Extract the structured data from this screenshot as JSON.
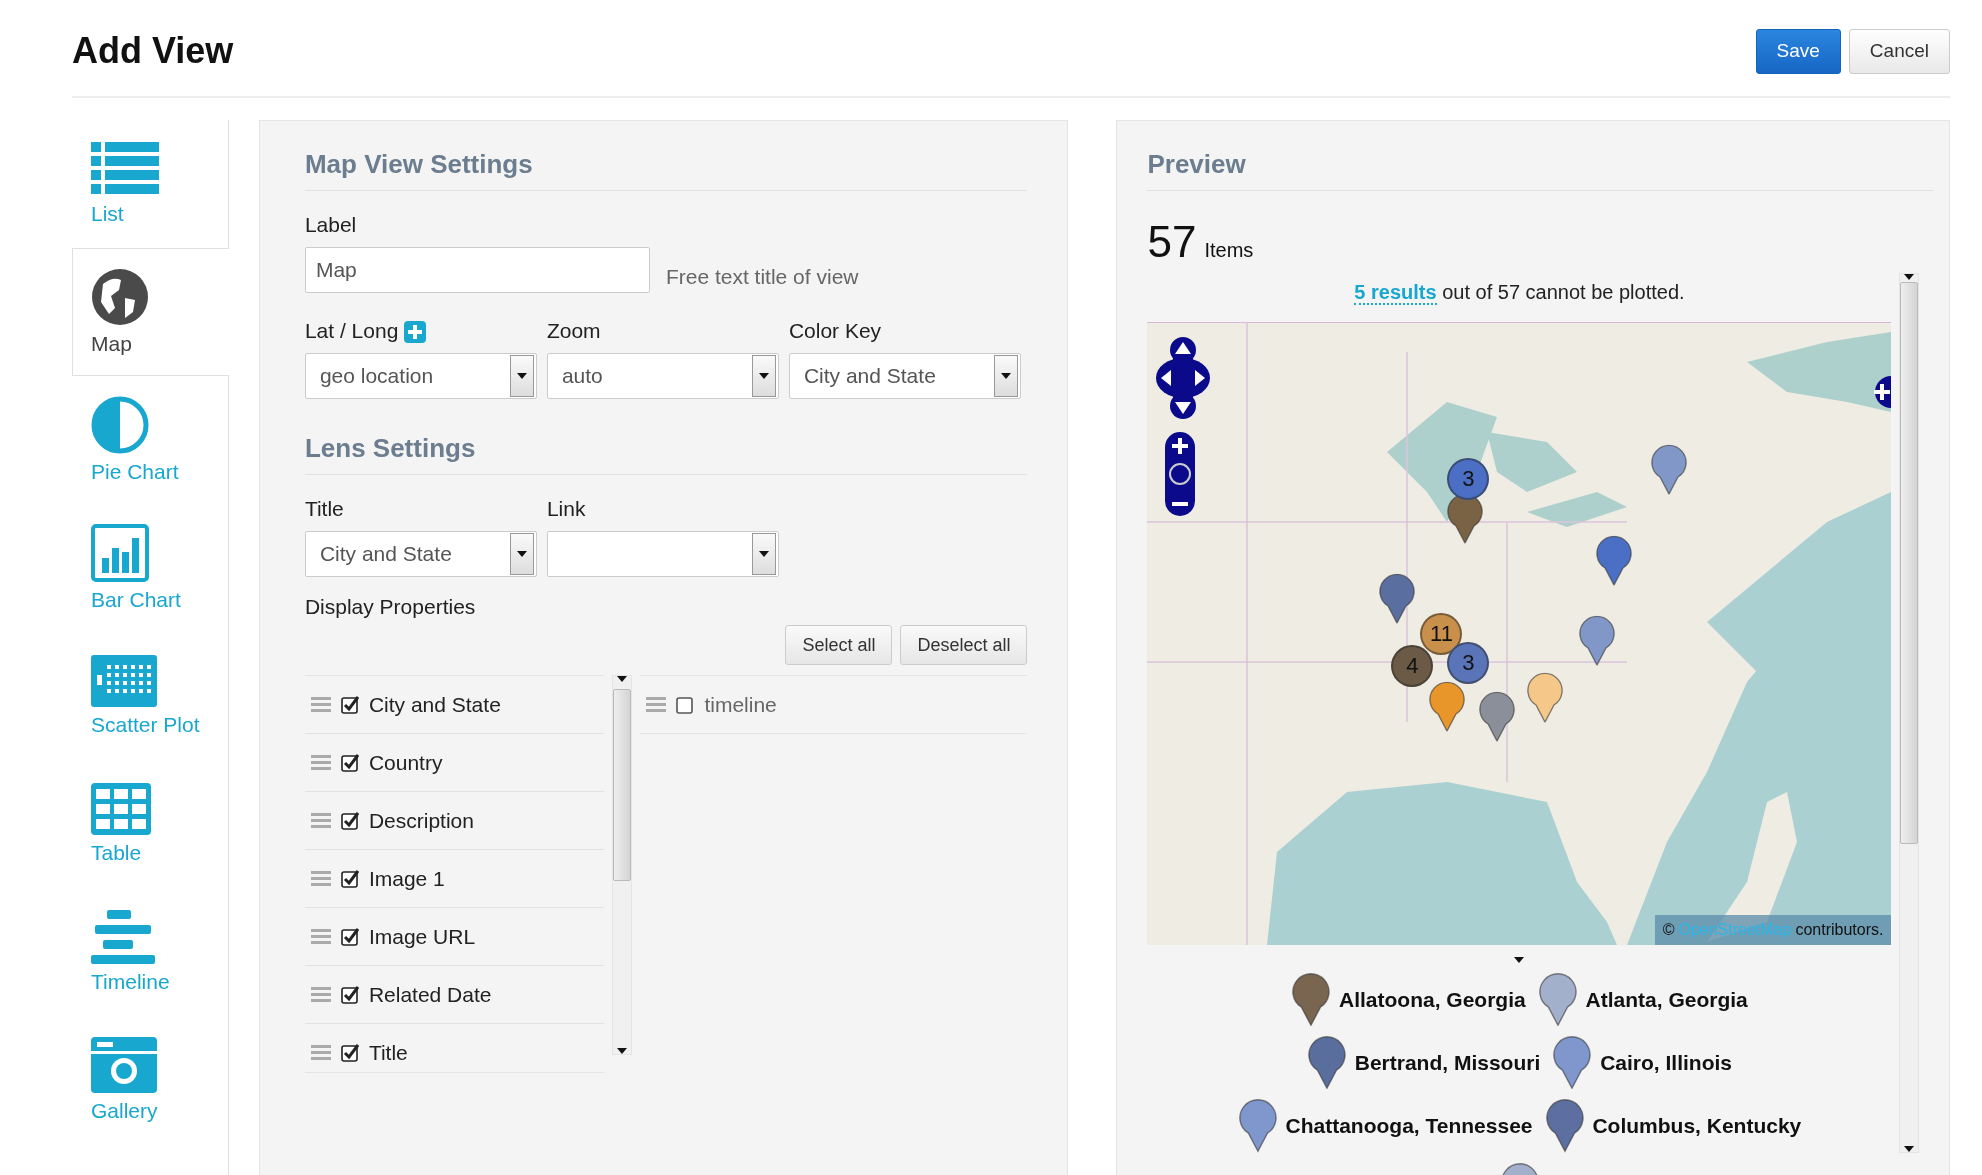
{
  "page": {
    "title": "Add View",
    "buttons": [
      {
        "label": "Save",
        "kind": "primary"
      },
      {
        "label": "Cancel",
        "kind": "default"
      }
    ]
  },
  "sidebar": {
    "items": [
      {
        "label": "List",
        "selected": false
      },
      {
        "label": "Map",
        "selected": true
      },
      {
        "label": "Pie Chart",
        "selected": false
      },
      {
        "label": "Bar Chart",
        "selected": false
      },
      {
        "label": "Scatter Plot",
        "selected": false
      },
      {
        "label": "Table",
        "selected": false
      },
      {
        "label": "Timeline",
        "selected": false
      },
      {
        "label": "Gallery",
        "selected": false
      }
    ]
  },
  "settings": {
    "title": "Map View Settings",
    "label_field": {
      "label": "Label",
      "value": "Map",
      "hint": "Free text title of view"
    },
    "selects": [
      {
        "label": "Lat / Long",
        "value": "geo location",
        "add": true
      },
      {
        "label": "Zoom",
        "value": "auto",
        "add": false
      },
      {
        "label": "Color Key",
        "value": "City and State",
        "add": false
      }
    ],
    "lens": {
      "title": "Lens Settings",
      "selects": [
        {
          "label": "Title",
          "value": "City and State"
        },
        {
          "label": "Link"
        }
      ],
      "display_label": "Display Properties",
      "buttons": [
        "Select all",
        "Deselect all"
      ],
      "shown": [
        {
          "label": "City and State",
          "checked": true
        },
        {
          "label": "Country",
          "checked": true
        },
        {
          "label": "Description",
          "checked": true
        },
        {
          "label": "Image 1",
          "checked": true
        },
        {
          "label": "Image URL",
          "checked": true
        },
        {
          "label": "Related Date",
          "checked": true
        },
        {
          "label": "Title",
          "checked": true
        }
      ],
      "hidden": [
        {
          "label": "timeline",
          "checked": false
        }
      ]
    }
  },
  "preview": {
    "title": "Preview",
    "count": "57",
    "count_label": "Items",
    "notice_link": "5 results",
    "notice": "out of 57 cannot be plotted.",
    "map": {
      "clusters": [
        {
          "label": "3",
          "color": "#4a6fc4"
        },
        {
          "label": "11",
          "color": "#c8904a"
        },
        {
          "label": "4",
          "color": "#6b5a45"
        },
        {
          "label": "3",
          "color": "#5a74b8"
        }
      ],
      "pins": [
        {
          "color": "#7a6245"
        },
        {
          "color": "#8097c8"
        },
        {
          "color": "#4a6fc4"
        },
        {
          "color": "#8097c8"
        },
        {
          "color": "#f5c88a"
        },
        {
          "color": "#5a6ea0"
        },
        {
          "color": "#e8962a"
        },
        {
          "color": "#8a8f9a"
        }
      ],
      "attribution_symbol": "©",
      "attribution_link": "OpenStreetMap",
      "attribution_text": "contributors."
    },
    "legend": [
      {
        "label": "Allatoona, Georgia",
        "color": "#7a6650"
      },
      {
        "label": "Atlanta, Georgia",
        "color": "#a3b0cc"
      },
      {
        "label": "Bertrand, Missouri",
        "color": "#5a6e9e"
      },
      {
        "label": "Cairo, Illinois",
        "color": "#7f97cc"
      },
      {
        "label": "Chattanooga, Tennessee",
        "color": "#7f97cc"
      },
      {
        "label": "Columbus, Kentucky",
        "color": "#5c6fa0"
      }
    ],
    "legend_trailing_pin": {
      "color": "#a3b0cc"
    }
  }
}
